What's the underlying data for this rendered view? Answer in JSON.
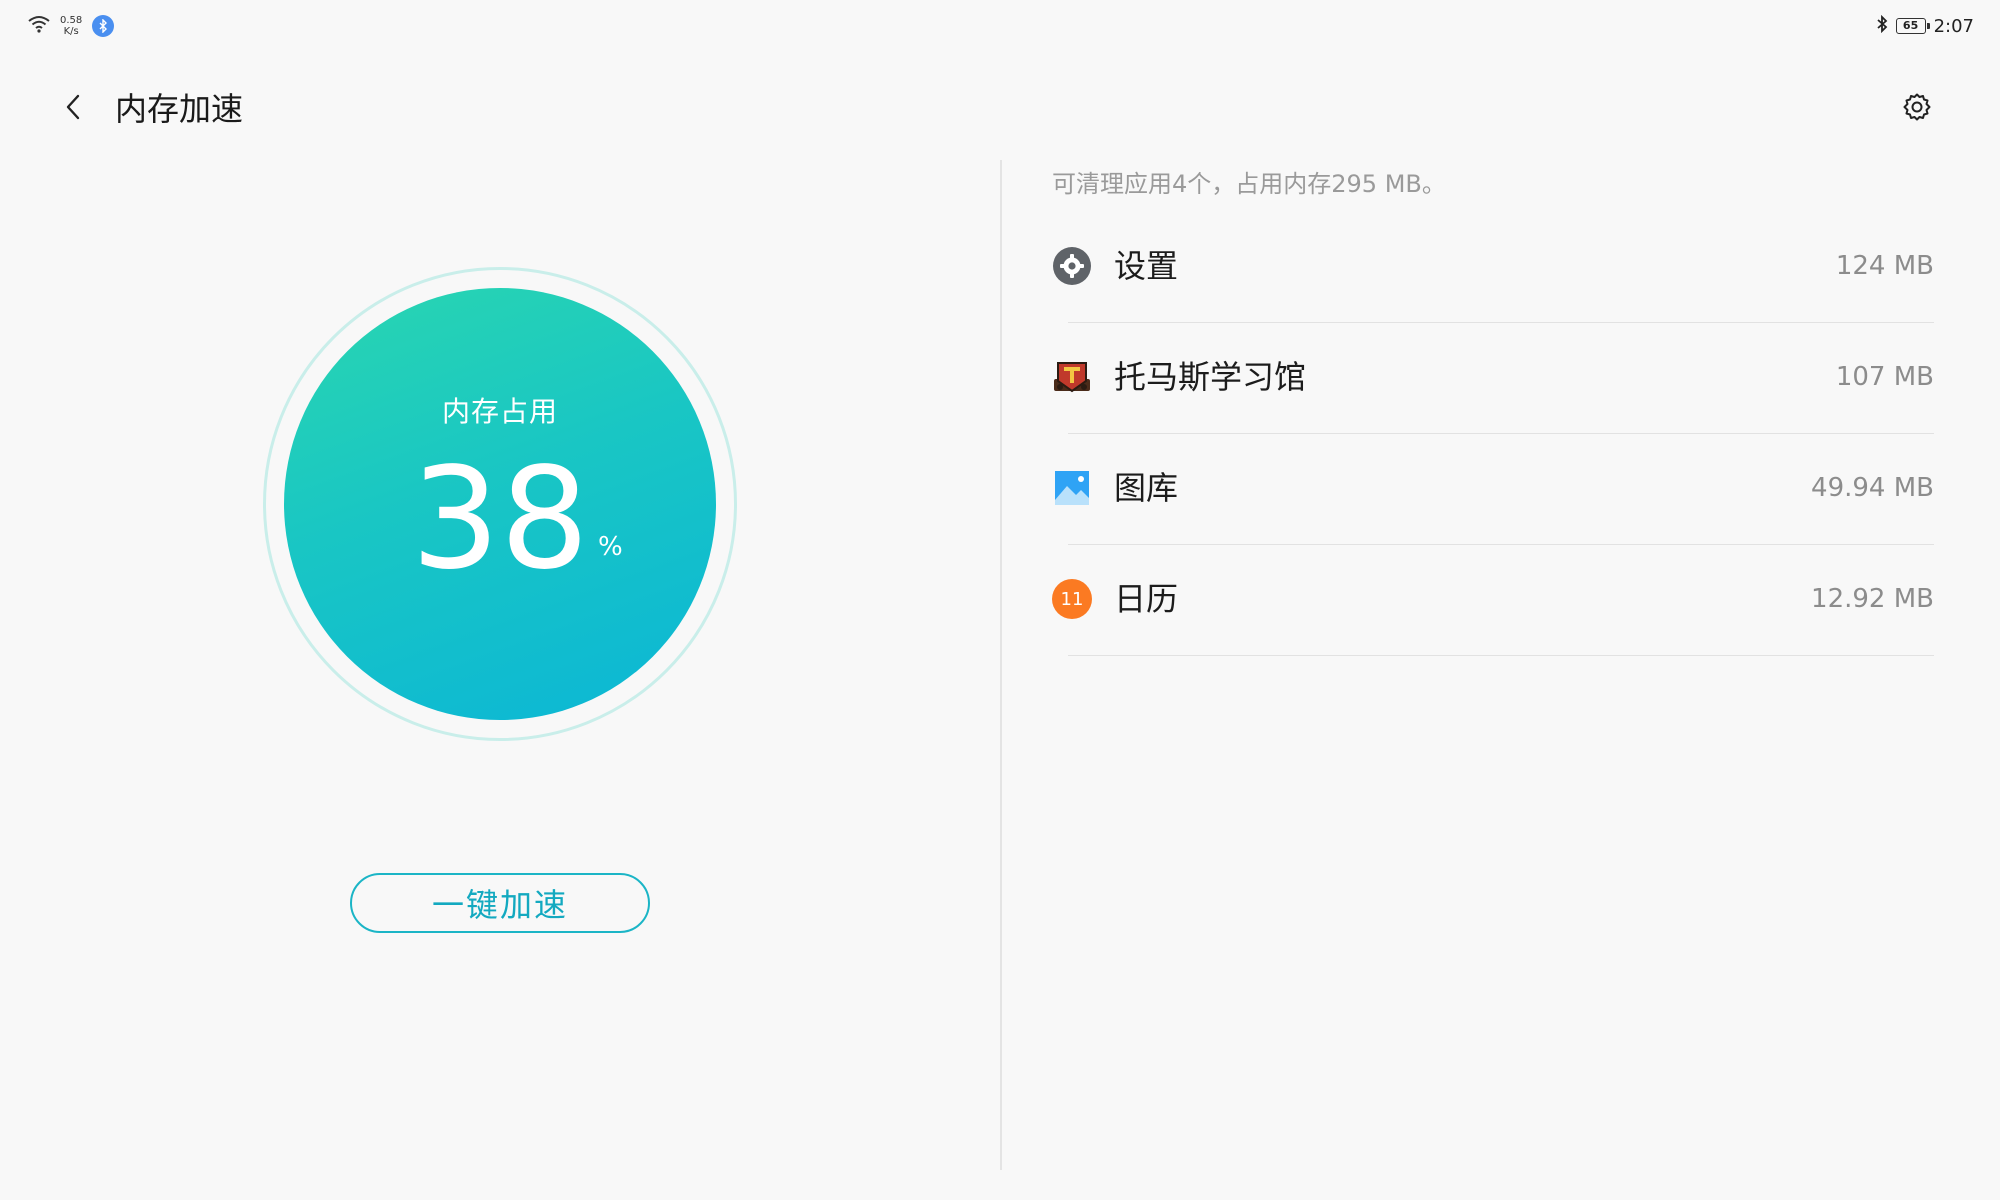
{
  "status_bar": {
    "net_speed_value": "0.58",
    "net_speed_unit": "K/s",
    "battery_level": "65",
    "time": "2:07",
    "icons": [
      "wifi-icon",
      "bluetooth-badge-icon",
      "bluetooth-icon",
      "battery-icon"
    ]
  },
  "header": {
    "title": "内存加速",
    "back_icon": "back-arrow-icon",
    "settings_icon": "gear-icon"
  },
  "gauge": {
    "label": "内存占用",
    "value": "38",
    "unit": "%",
    "colors": {
      "start": "#2ad6b0",
      "end": "#0bb6d6",
      "ring": "#c9eeea"
    }
  },
  "boost_button": {
    "label": "一键加速",
    "color": "#13a9c0"
  },
  "summary": "可清理应用4个，占用内存295 MB。",
  "apps": [
    {
      "name": "设置",
      "size": "124 MB",
      "icon": "settings-app-icon"
    },
    {
      "name": "托马斯学习馆",
      "size": "107 MB",
      "icon": "thomas-learning-app-icon"
    },
    {
      "name": "图库",
      "size": "49.94 MB",
      "icon": "gallery-app-icon"
    },
    {
      "name": "日历",
      "size": "12.92 MB",
      "icon": "calendar-app-icon",
      "badge": "11"
    }
  ]
}
